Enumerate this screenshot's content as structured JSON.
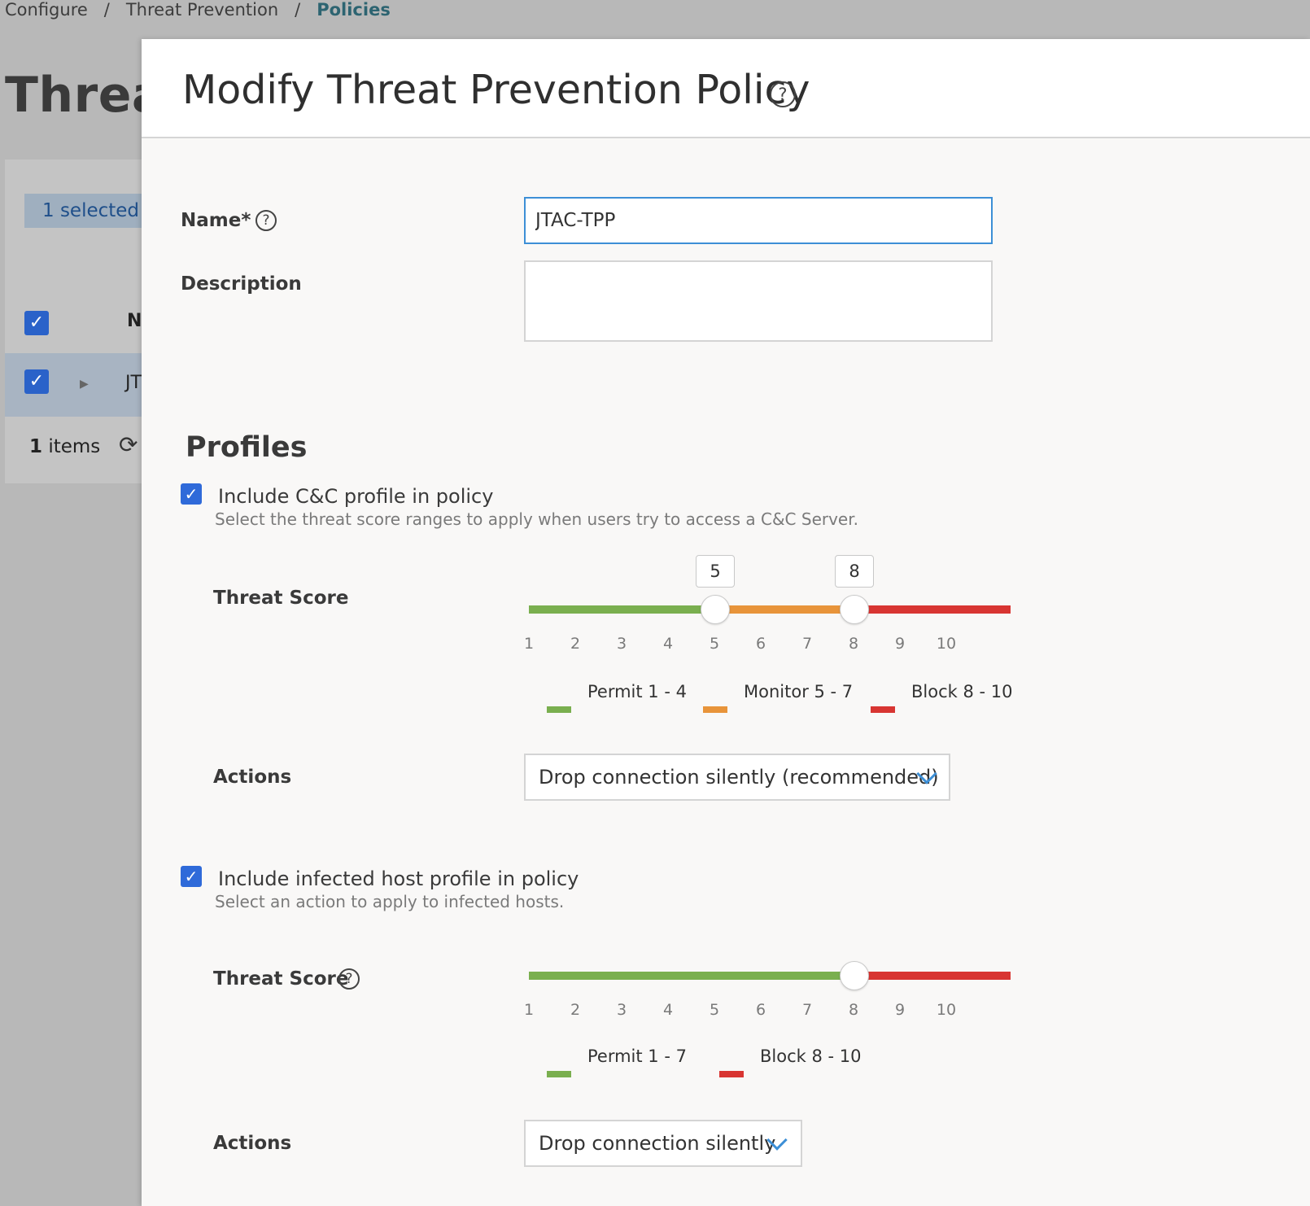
{
  "breadcrumb": {
    "items": [
      "Configure",
      "Threat Prevention"
    ],
    "separator": "/",
    "current": "Policies"
  },
  "background": {
    "title": "Threa",
    "selected_badge": "1 selected",
    "column_header": "N",
    "row_text": "JT",
    "footer_count": "1",
    "footer_label": " items"
  },
  "modal": {
    "title": "Modify Threat Prevention Policy",
    "name_label": "Name*",
    "name_value": "JTAC-TPP",
    "description_label": "Description",
    "description_value": "",
    "profiles_title": "Profiles",
    "cc": {
      "checkbox_label": "Include C&C profile in policy",
      "subtext": "Select the threat score ranges to apply when users try to access a C&C Server.",
      "threat_score_label": "Threat Score",
      "thumb_low": "5",
      "thumb_high": "8",
      "ticks": [
        "1",
        "2",
        "3",
        "4",
        "5",
        "6",
        "7",
        "8",
        "9",
        "10"
      ],
      "legend": [
        {
          "label": "Permit 1 - 4",
          "color": "#7aaf4f"
        },
        {
          "label": "Monitor 5 - 7",
          "color": "#e8943a"
        },
        {
          "label": "Block 8 - 10",
          "color": "#d83532"
        }
      ],
      "actions_label": "Actions",
      "action_value": "Drop connection silently (recommended)"
    },
    "infected": {
      "checkbox_label": "Include infected host profile in policy",
      "subtext": "Select an action to apply to infected hosts.",
      "threat_score_label": "Threat Score",
      "ticks": [
        "1",
        "2",
        "3",
        "4",
        "5",
        "6",
        "7",
        "8",
        "9",
        "10"
      ],
      "legend": [
        {
          "label": "Permit 1 - 7",
          "color": "#7aaf4f"
        },
        {
          "label": "Block 8 - 10",
          "color": "#d83532"
        }
      ],
      "actions_label": "Actions",
      "action_value": "Drop connection silently"
    }
  }
}
